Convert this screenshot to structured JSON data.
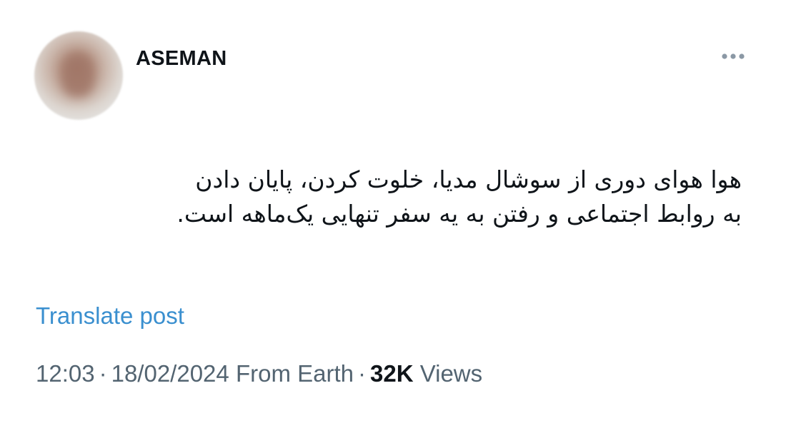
{
  "post": {
    "username": "ASEMAN",
    "text_lines": [
      "هوا هوای دوری از سوشال مدیا، خلوت کردن، پایان دادن",
      "به روابط اجتماعی و رفتن به یه سفر تنهایی یک‌ماهه است."
    ],
    "translate_label": "Translate post",
    "time": "12:03",
    "separator": "·",
    "date": "18/02/2024",
    "source": "From Earth",
    "views_count": "32K",
    "views_label": "Views",
    "more_icon": "more-horizontal-icon"
  },
  "colors": {
    "text_primary": "#0f1419",
    "text_secondary": "#536471",
    "link": "#3a8fcf",
    "more_icon": "#8b98a5"
  }
}
